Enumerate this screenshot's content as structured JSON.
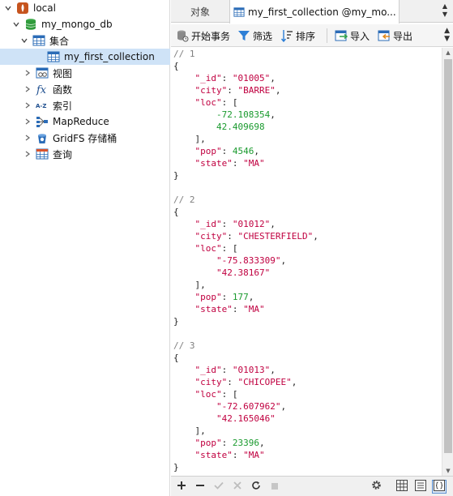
{
  "tree": {
    "connection": "local",
    "database": "my_mongo_db",
    "collections_folder": "集合",
    "collection": "my_first_collection",
    "views": "视图",
    "functions": "函数",
    "indexes": "索引",
    "mapreduce": "MapReduce",
    "gridfs": "GridFS 存储桶",
    "queries": "查询"
  },
  "tabs": {
    "objects": "对象",
    "collection": "my_first_collection @my_mo..."
  },
  "toolbar": {
    "begin_transaction": "开始事务",
    "filter": "筛选",
    "sort": "排序",
    "import": "导入",
    "export": "导出"
  },
  "documents": [
    {
      "comment": "// 1",
      "id": "\"01005\"",
      "city": "\"BARRE\"",
      "loc": [
        "-72.108354",
        "42.409698"
      ],
      "loc_quoted": false,
      "pop": "4546",
      "state": "\"MA\""
    },
    {
      "comment": "// 2",
      "id": "\"01012\"",
      "city": "\"CHESTERFIELD\"",
      "loc": [
        "\"-75.833309\"",
        "\"42.38167\""
      ],
      "loc_quoted": true,
      "pop": "177",
      "state": "\"MA\""
    },
    {
      "comment": "// 3",
      "id": "\"01013\"",
      "city": "\"CHICOPEE\"",
      "loc": [
        "\"-72.607962\"",
        "\"42.165046\""
      ],
      "loc_quoted": true,
      "pop": "23396",
      "state": "\"MA\""
    }
  ],
  "keys": {
    "id": "\"_id\"",
    "city": "\"city\"",
    "loc": "\"loc\"",
    "pop": "\"pop\"",
    "state": "\"state\""
  },
  "colors": {
    "selection": "#cfe3f7",
    "key": "#c00040",
    "number": "#1a9a2e",
    "comment": "#7f7f7f"
  }
}
